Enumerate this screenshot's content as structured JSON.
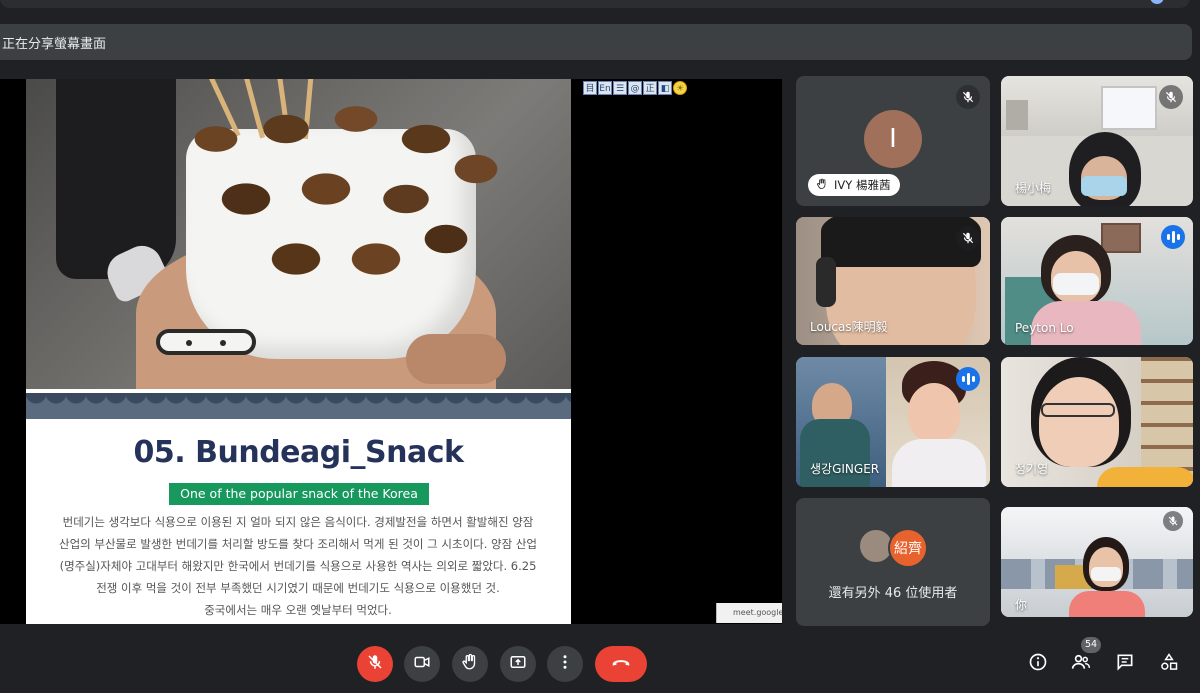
{
  "banner": {
    "text": "正在分享螢幕畫面"
  },
  "slide": {
    "title": "05. Bundeagi_Snack",
    "tag": "One of the  popular snack of the Korea",
    "body_lines": [
      "번데기는 생각보다 식용으로 이용된 지 얼마 되지 않은 음식이다. 경제발전을 하면서 활발해진 양잠",
      "산업의 부산물로 발생한 번데기를 처리할 방도를 찾다 조리해서 먹게 된 것이 그 시초이다. 양잠 산업",
      "(명주실)자체야 고대부터 해왔지만 한국에서 번데기를 식용으로 사용한 역사는 의외로 짧았다. 6.25",
      "전쟁 이후 먹을 것이 전부 부족했던 시기였기 때문에 번데기도 식용으로 이용했던 것.",
      "중국에서는 매우 오랜 옛날부터 먹었다."
    ],
    "toolbar_icons": [
      "目",
      "En",
      "☰",
      "@",
      "正",
      "◧",
      "☀"
    ],
    "url_hint": "meet.google.c"
  },
  "participants": [
    {
      "name": "IVY 楊雅茜",
      "initial": "I",
      "muted": true,
      "speaking": false,
      "hand": true
    },
    {
      "name": "楊小梅",
      "muted": true,
      "speaking": false
    },
    {
      "name": "Loucas陳明毅",
      "muted": true,
      "speaking": false
    },
    {
      "name": "Peyton Lo",
      "muted": false,
      "speaking": true
    },
    {
      "name": "생강GINGER",
      "muted": false,
      "speaking": true
    },
    {
      "name": "정기영",
      "muted": false,
      "speaking": false
    },
    {
      "name": "你",
      "muted": true,
      "speaking": false
    }
  ],
  "others": {
    "avatar_label": "紹齊",
    "text": "還有另外 46 位使用者"
  },
  "controls": {
    "people_count": "54"
  },
  "colors": {
    "end_call": "#ea4335",
    "accent": "#8ab4f8",
    "tag_green": "#17995e",
    "title_navy": "#25335a"
  }
}
